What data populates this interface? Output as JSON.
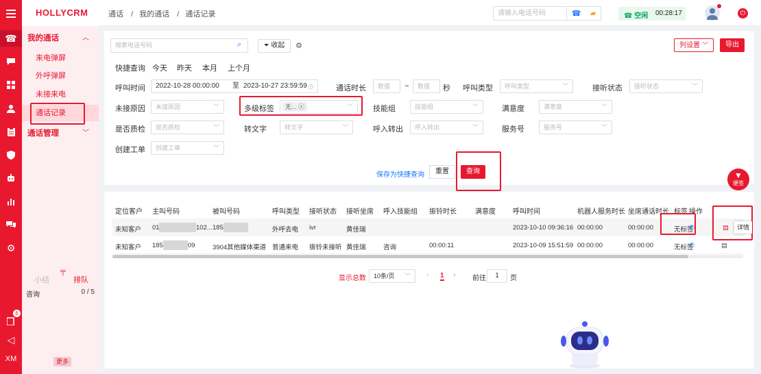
{
  "app": {
    "name": "HOLLYCRM"
  },
  "rail": {
    "badge": "6",
    "user_initials": "XM"
  },
  "sidebar": {
    "groups": [
      {
        "label": "我的通话",
        "items": [
          "来电弹屏",
          "外呼弹屏",
          "未接来电",
          "通话记录"
        ],
        "selected": "通话记录"
      },
      {
        "label": "通话管理"
      }
    ],
    "bottom_tabs": [
      "小结",
      "排队"
    ],
    "queue": {
      "name": "咨询",
      "count": "0 / 5"
    },
    "more_label": "更多"
  },
  "header": {
    "breadcrumb": [
      "通话",
      "我的通话",
      "通话记录"
    ],
    "phone_placeholder": "请输入电话号码",
    "status_label": "空闲",
    "timer": "00:28:17"
  },
  "filter": {
    "search_placeholder": "搜索电话号码",
    "collapse_label": "收起",
    "column_settings_label": "列设置",
    "export_label": "导出",
    "quick_label": "快捷查询",
    "quick_options": [
      "今天",
      "昨天",
      "本月",
      "上个月"
    ],
    "call_time_label": "呼叫时间",
    "date_start": "2022-10-28 00:00:00",
    "date_sep": "至",
    "date_end": "2023-10-27 23:59:59",
    "duration_label": "通话时长",
    "duration_min_placeholder": "数值",
    "duration_tilde": "~",
    "duration_max_placeholder": "数值",
    "duration_unit": "秒",
    "call_type_label": "呼叫类型",
    "call_type_placeholder": "呼叫类型",
    "answer_state_label": "接听状态",
    "answer_state_placeholder": "接听状态",
    "missed_reason_label": "未接原因",
    "missed_reason_placeholder": "未接原因",
    "multi_tag_label": "多级标签",
    "multi_tag_value": "无...",
    "skill_group_label": "技能组",
    "skill_group_placeholder": "技能组",
    "satisfaction_label": "满意度",
    "satisfaction_placeholder": "满意度",
    "qc_label": "是否质检",
    "qc_placeholder": "是否质检",
    "transcribe_label": "转文字",
    "transcribe_placeholder": "转文字",
    "transfer_label": "呼入转出",
    "transfer_placeholder": "呼入转出",
    "service_no_label": "服务号",
    "service_no_placeholder": "服务号",
    "ticket_label": "创建工单",
    "ticket_placeholder": "创建工单",
    "save_quick_label": "保存为快捷查询",
    "reset_label": "重置",
    "query_label": "查询"
  },
  "table": {
    "headers": [
      "定位客户",
      "主叫号码",
      "被叫号码",
      "呼叫类型",
      "接听状态",
      "接听坐席",
      "呼入技能组",
      "振铃时长",
      "满意度",
      "呼叫时间",
      "机器人服务时长",
      "坐席通话时长",
      "标签",
      "操作"
    ],
    "rows": [
      {
        "customer": "未知客户",
        "caller_a": "01",
        "caller_b": "102...",
        "callee": "185",
        "type": "外呼去电",
        "state": "ivr",
        "agent": "黄佳瑞",
        "skill": "",
        "ring": "",
        "satisfaction": "",
        "time": "2023-10-10 09:36:16",
        "robot": "00:00:00",
        "agent_dur": "00:00:00",
        "tag": "无标签"
      },
      {
        "customer": "未知客户",
        "caller_a": "185",
        "caller_b": "09",
        "callee": "3904其他媒体渠道",
        "type": "普通来电",
        "state": "振铃未接听",
        "agent": "黄佳瑞",
        "skill": "咨询",
        "ring": "00:00:11",
        "satisfaction": "",
        "time": "2023-10-09 15:51:59",
        "robot": "00:00:00",
        "agent_dur": "00:00:00",
        "tag": "无标签"
      }
    ],
    "tooltip": "详情"
  },
  "pager": {
    "total_label": "显示总数",
    "page_size": "10条/页",
    "current_page": "1",
    "goto_label": "前往",
    "goto_value": "1",
    "page_unit": "页"
  },
  "fab_label": "便签",
  "colors": {
    "brand": "#e8182f",
    "sidebar_bg": "#fdeef0",
    "link": "#1677ff",
    "idle": "#0aa35a"
  }
}
